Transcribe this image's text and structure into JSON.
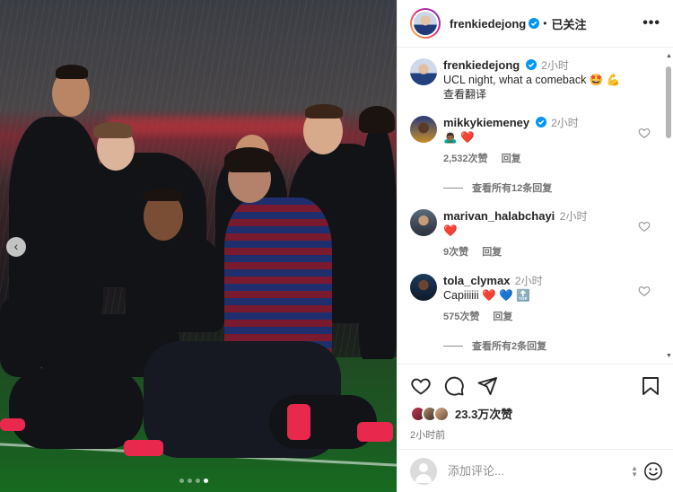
{
  "colors": {
    "verified": "#0095f6",
    "heart": "#ed4956",
    "muted": "#737373",
    "text": "#262626"
  },
  "header": {
    "username": "frenkiedejong",
    "separator": "•",
    "follow_status": "已关注",
    "more_icon": "more-horizontal-icon"
  },
  "caption": {
    "username": "frenkiedejong",
    "time": "2小时",
    "text": "UCL night, what a comeback 🤩 💪",
    "translate": "查看翻译"
  },
  "comments": [
    {
      "username": "mikkykiemeney",
      "verified": true,
      "time": "2小时",
      "text": "🙇🏾‍♂️ ❤️",
      "likes": "2,532次赞",
      "reply": "回复",
      "view_replies": "查看所有12条回复"
    },
    {
      "username": "marivan_halabchayi",
      "verified": false,
      "time": "2小时",
      "text": "❤️",
      "likes": "9次赞",
      "reply": "回复",
      "view_replies": ""
    },
    {
      "username": "tola_clymax",
      "verified": false,
      "time": "2小时",
      "text": "Capiiiiii ❤️ 💙 🔝",
      "likes": "575次赞",
      "reply": "回复",
      "view_replies": "查看所有2条回复"
    }
  ],
  "actions": {
    "like_icon": "heart-icon",
    "comment_icon": "comment-icon",
    "share_icon": "send-icon",
    "save_icon": "bookmark-icon"
  },
  "likes_text": "23.3万次赞",
  "posted_ago": "2小时前",
  "add_comment": {
    "placeholder": "添加评论...",
    "emoji_icon": "smiley-icon"
  },
  "media": {
    "slides": 4,
    "active_slide": 4,
    "nav_icon": "chevron-left-icon"
  }
}
